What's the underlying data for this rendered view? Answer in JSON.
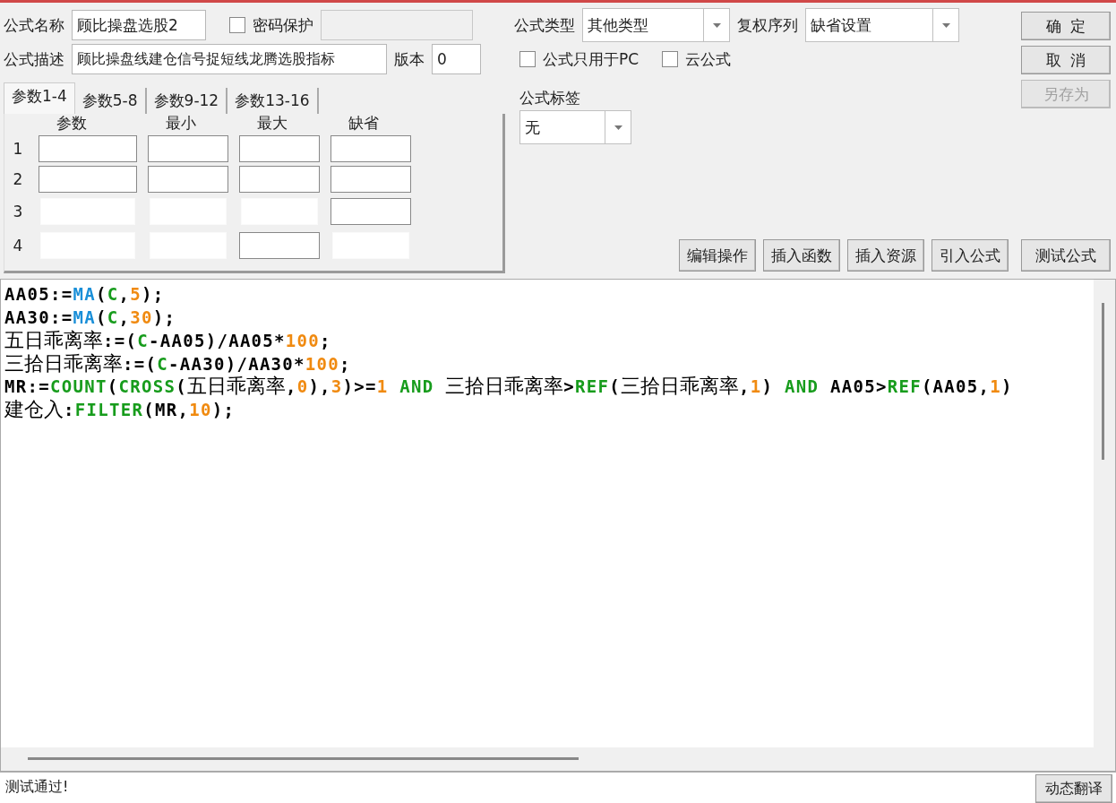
{
  "formula_name": {
    "label": "公式名称",
    "value": "顾比操盘选股2"
  },
  "password": {
    "label": "密码保护",
    "checked": false
  },
  "description": {
    "label": "公式描述",
    "value": "顾比操盘线建仓信号捉短线龙腾选股指标"
  },
  "version": {
    "label": "版本",
    "value": "0"
  },
  "formula_type": {
    "label": "公式类型",
    "value": "其他类型"
  },
  "adjust_sequence": {
    "label": "复权序列",
    "value": "缺省设置"
  },
  "options": [
    {
      "label": "公式只用于PC",
      "checked": false
    },
    {
      "label": "云公式",
      "checked": false
    }
  ],
  "tag": {
    "label": "公式标签",
    "value": "无"
  },
  "side_buttons": [
    {
      "label": "确  定",
      "disabled": false
    },
    {
      "label": "取  消",
      "disabled": false
    },
    {
      "label": "另存为",
      "disabled": true
    }
  ],
  "tabs": [
    {
      "label": "参数1-4",
      "selected": true
    },
    {
      "label": "参数5-8",
      "selected": false
    },
    {
      "label": "参数9-12",
      "selected": false
    },
    {
      "label": "参数13-16",
      "selected": false
    }
  ],
  "param_columns": [
    "参数",
    "最小",
    "最大",
    "缺省"
  ],
  "param_rows": [
    {
      "label": "1",
      "cells": [
        {
          "enabled": true
        },
        {
          "enabled": true
        },
        {
          "enabled": true
        },
        {
          "enabled": true
        }
      ]
    },
    {
      "label": "2",
      "cells": [
        {
          "enabled": true
        },
        {
          "enabled": true
        },
        {
          "enabled": true
        },
        {
          "enabled": true
        }
      ]
    },
    {
      "label": "3",
      "cells": [
        {
          "enabled": false
        },
        {
          "enabled": false
        },
        {
          "enabled": false
        },
        {
          "enabled": true
        }
      ]
    },
    {
      "label": "4",
      "cells": [
        {
          "enabled": false
        },
        {
          "enabled": false
        },
        {
          "enabled": true
        },
        {
          "enabled": false
        }
      ]
    }
  ],
  "tool_buttons": [
    "编辑操作",
    "插入函数",
    "插入资源",
    "引入公式",
    "测试公式"
  ],
  "code_lines": [
    [
      {
        "text": "AA05:=",
        "kind": "ident"
      },
      {
        "text": "MA",
        "kind": "func_blue"
      },
      {
        "text": "(",
        "kind": "ident"
      },
      {
        "text": "C",
        "kind": "green"
      },
      {
        "text": ",",
        "kind": "ident"
      },
      {
        "text": "5",
        "kind": "number"
      },
      {
        "text": ");",
        "kind": "ident"
      }
    ],
    [
      {
        "text": "AA30:=",
        "kind": "ident"
      },
      {
        "text": "MA",
        "kind": "func_blue"
      },
      {
        "text": "(",
        "kind": "ident"
      },
      {
        "text": "C",
        "kind": "green"
      },
      {
        "text": ",",
        "kind": "ident"
      },
      {
        "text": "30",
        "kind": "number"
      },
      {
        "text": ");",
        "kind": "ident"
      }
    ],
    [
      {
        "text": "五日乖离率",
        "kind": "cjk"
      },
      {
        "text": ":=(",
        "kind": "ident"
      },
      {
        "text": "C",
        "kind": "green"
      },
      {
        "text": "-AA05)/AA05*",
        "kind": "ident"
      },
      {
        "text": "100",
        "kind": "number"
      },
      {
        "text": ";",
        "kind": "ident"
      }
    ],
    [
      {
        "text": "三拾日乖离率",
        "kind": "cjk"
      },
      {
        "text": ":=(",
        "kind": "ident"
      },
      {
        "text": "C",
        "kind": "green"
      },
      {
        "text": "-AA30)/AA30*",
        "kind": "ident"
      },
      {
        "text": "100",
        "kind": "number"
      },
      {
        "text": ";",
        "kind": "ident"
      }
    ],
    [
      {
        "text": "MR:=",
        "kind": "ident"
      },
      {
        "text": "COUNT",
        "kind": "green"
      },
      {
        "text": "(",
        "kind": "ident"
      },
      {
        "text": "CROSS",
        "kind": "green"
      },
      {
        "text": "(",
        "kind": "ident"
      },
      {
        "text": "五日乖离率",
        "kind": "cjk"
      },
      {
        "text": ",",
        "kind": "ident"
      },
      {
        "text": "0",
        "kind": "number"
      },
      {
        "text": "),",
        "kind": "ident"
      },
      {
        "text": "3",
        "kind": "number"
      },
      {
        "text": ")>=",
        "kind": "ident"
      },
      {
        "text": "1",
        "kind": "number"
      },
      {
        "text": " AND ",
        "kind": "green"
      },
      {
        "text": "三拾日乖离率",
        "kind": "cjk"
      },
      {
        "text": ">",
        "kind": "ident"
      },
      {
        "text": "REF",
        "kind": "green"
      },
      {
        "text": "(",
        "kind": "ident"
      },
      {
        "text": "三拾日乖离率",
        "kind": "cjk"
      },
      {
        "text": ",",
        "kind": "ident"
      },
      {
        "text": "1",
        "kind": "number"
      },
      {
        "text": ")",
        "kind": "ident"
      },
      {
        "text": " AND ",
        "kind": "green"
      },
      {
        "text": "AA05>",
        "kind": "ident"
      },
      {
        "text": "REF",
        "kind": "green"
      },
      {
        "text": "(AA05,",
        "kind": "ident"
      },
      {
        "text": "1",
        "kind": "number"
      },
      {
        "text": ")",
        "kind": "ident"
      }
    ],
    [
      {
        "text": "建仓入",
        "kind": "cjk"
      },
      {
        "text": ":",
        "kind": "ident"
      },
      {
        "text": "FILTER",
        "kind": "green"
      },
      {
        "text": "(MR,",
        "kind": "ident"
      },
      {
        "text": "10",
        "kind": "number"
      },
      {
        "text": ");",
        "kind": "ident"
      }
    ]
  ],
  "status": {
    "message": "测试通过!",
    "button": "动态翻译"
  }
}
